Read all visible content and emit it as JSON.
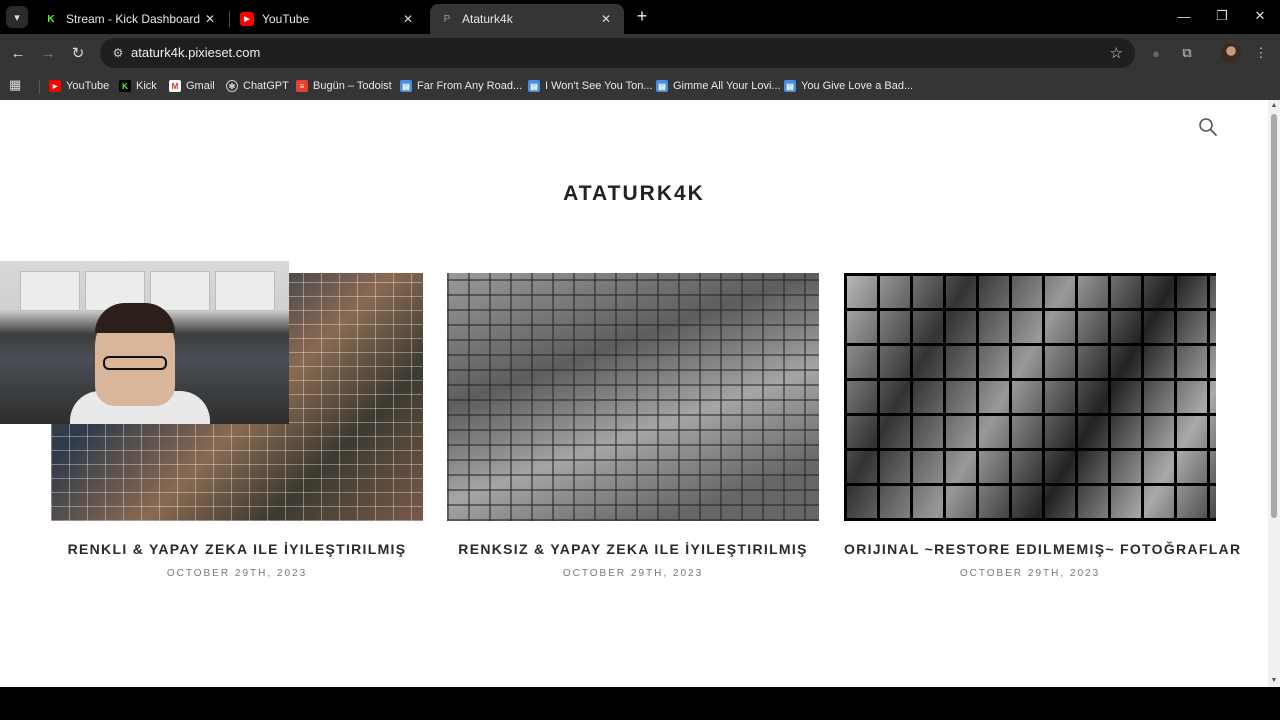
{
  "browser": {
    "tabs": [
      {
        "title": "Stream - Kick Dashboard",
        "favicon": "kick-icon"
      },
      {
        "title": "YouTube",
        "favicon": "youtube-icon"
      },
      {
        "title": "Ataturk4k",
        "favicon": "pixieset-icon",
        "active": true
      }
    ],
    "url": "ataturk4k.pixieset.com",
    "bookmarks": [
      {
        "label": "YouTube",
        "icon": "youtube-icon"
      },
      {
        "label": "Kick",
        "icon": "kick-icon"
      },
      {
        "label": "Gmail",
        "icon": "gmail-icon"
      },
      {
        "label": "ChatGPT",
        "icon": "chatgpt-icon"
      },
      {
        "label": "Bugün – Todoist",
        "icon": "todoist-icon"
      },
      {
        "label": "Far From Any Road...",
        "icon": "doc-icon"
      },
      {
        "label": "I Won't See You Ton...",
        "icon": "doc-icon"
      },
      {
        "label": "Gimme All Your Lovi...",
        "icon": "doc-icon"
      },
      {
        "label": "You Give Love a Bad...",
        "icon": "doc-icon"
      }
    ]
  },
  "site": {
    "title": "ATATURK4K",
    "galleries": [
      {
        "title": "RENKLI & YAPAY ZEKA ILE İYILEŞTIRILMIŞ",
        "date": "OCTOBER 29TH, 2023",
        "style": "color"
      },
      {
        "title": "RENKSIZ & YAPAY ZEKA ILE İYILEŞTIRILMIŞ",
        "date": "OCTOBER 29TH, 2023",
        "style": "gray"
      },
      {
        "title": "ORIJINAL ~RESTORE EDILMEMIŞ~ FOTOĞRAFLAR",
        "date": "OCTOBER 29TH, 2023",
        "style": "bw"
      }
    ]
  },
  "colors": {
    "kick": "#53fc18",
    "youtube": "#ff0000",
    "page_bg": "#ffffff",
    "title": "#222222"
  }
}
